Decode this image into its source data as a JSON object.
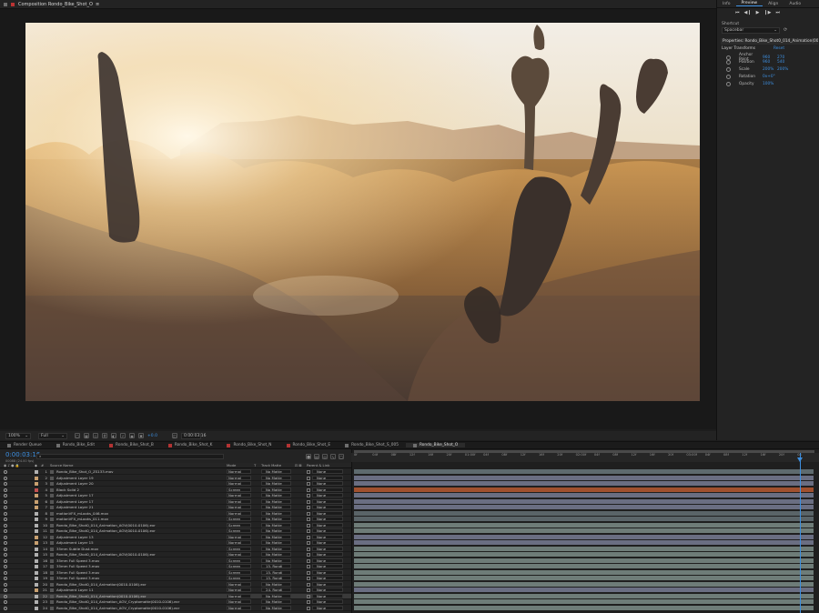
{
  "composition_panel": {
    "tab_label": "Composition Rondo_Bike_Shot_O",
    "zoom": "100%",
    "resolution": "Full",
    "exposure": "+0.0",
    "timecode": "0:00:03:16"
  },
  "right_panel": {
    "tabs": [
      "Info",
      "Preview",
      "Align",
      "Audio"
    ],
    "active_tab": "Preview",
    "transport": [
      "⏮",
      "◀❙",
      "▶",
      "❙▶",
      "⏭"
    ],
    "shortcut_label": "Shortcut",
    "shortcut_value": "Spacebar",
    "properties_header": "Properties: Rondo_Bike_Shot0_014_Animation(0010-",
    "layer_transforms_label": "Layer Transforms",
    "reset_label": "Reset",
    "properties": [
      {
        "name": "Anchor Point",
        "v1": "960",
        "v2": "270"
      },
      {
        "name": "Position",
        "v1": "960",
        "v2": "540"
      },
      {
        "name": "Scale",
        "v1": "200%",
        "v2": "200%"
      },
      {
        "name": "Rotation",
        "v1": "0x+0°",
        "v2": ""
      },
      {
        "name": "Opacity",
        "v1": "100%",
        "v2": ""
      }
    ]
  },
  "timeline_tabs": [
    {
      "label": "Render Queue",
      "color": "#6e6e6e",
      "active": false
    },
    {
      "label": "Rondo_Bike_Edit",
      "color": "#6e6e6e",
      "active": false
    },
    {
      "label": "Rondo_Bike_Shot_B",
      "color": "#b33333",
      "active": false
    },
    {
      "label": "Rondo_Bike_Shot_K",
      "color": "#b33333",
      "active": false
    },
    {
      "label": "Rondo_Bike_Shot_N",
      "color": "#b33333",
      "active": false
    },
    {
      "label": "Rondo_Bike_Shot_E",
      "color": "#b33333",
      "active": false
    },
    {
      "label": "Rondo_Bike_Shot_S_005",
      "color": "#6e6e6e",
      "active": false
    },
    {
      "label": "Rondo_Bike_Shot_O",
      "color": "#6e6e6e",
      "active": true
    }
  ],
  "timeline": {
    "current_time": "0:00:03:16",
    "fps_label": "00088 (24.00 fps)",
    "search_placeholder": "⌕",
    "columns": {
      "source_name": "Source Name",
      "mode": "Mode",
      "t": "T",
      "trkmat": "Track Matte",
      "parent": "Parent & Link"
    },
    "ruler_ticks": [
      "0f",
      "04f",
      "08f",
      "12f",
      "16f",
      "20f",
      "01:00f",
      "04f",
      "08f",
      "12f",
      "16f",
      "20f",
      "02:00f",
      "04f",
      "08f",
      "12f",
      "16f",
      "20f",
      "03:00f",
      "04f",
      "08f",
      "12f",
      "16f",
      "20f",
      "04"
    ],
    "layers": [
      {
        "num": "1",
        "name": "Rondo_Bike_Shot_O_ZS133.mov",
        "mode": "Normal",
        "matte": "No Matte",
        "parent": "None",
        "label": "#b0b0b0",
        "bar": "#5e6a6e"
      },
      {
        "num": "2",
        "name": "Adjustment Layer 19",
        "mode": "Normal",
        "matte": "No Matte",
        "parent": "None",
        "label": "#c8a070",
        "bar": "#6a6e82"
      },
      {
        "num": "3",
        "name": "Adjustment Layer 20",
        "mode": "Normal",
        "matte": "No Matte",
        "parent": "None",
        "label": "#c8a070",
        "bar": "#6a6e82"
      },
      {
        "num": "4",
        "name": "Black Solid 2",
        "mode": "Screen",
        "matte": "No Matte",
        "parent": "None",
        "label": "#c25050",
        "bar": "#a0502e"
      },
      {
        "num": "5",
        "name": "Adjustment Layer 17",
        "mode": "Normal",
        "matte": "No Matte",
        "parent": "None",
        "label": "#c8a070",
        "bar": "#6a6e82"
      },
      {
        "num": "6",
        "name": "Adjustment Layer 17",
        "mode": "Normal",
        "matte": "No Matte",
        "parent": "None",
        "label": "#c8a070",
        "bar": "#6a6e82"
      },
      {
        "num": "7",
        "name": "Adjustment Layer 21",
        "mode": "Normal",
        "matte": "No Matte",
        "parent": "None",
        "label": "#c8a070",
        "bar": "#6a6e82"
      },
      {
        "num": "8",
        "name": "motionVFX_mLooks_046.mov",
        "mode": "Normal",
        "matte": "No Matte",
        "parent": "None",
        "label": "#b0b0b0",
        "bar": "#5a6468"
      },
      {
        "num": "9",
        "name": "motionVFX_mLooks_011.mov",
        "mode": "Screen",
        "matte": "No Matte",
        "parent": "None",
        "label": "#b0b0b0",
        "bar": "#5a6468"
      },
      {
        "num": "10",
        "name": "Rondo_Bike_Shot0_014_Animation_AOV(0010-0106).exr",
        "mode": "Screen",
        "matte": "No Matte",
        "parent": "None",
        "label": "#b0b0b0",
        "bar": "#6e7c78"
      },
      {
        "num": "11",
        "name": "Rondo_Bike_Shot0_014_Animation_AOV(0010-0106).exr",
        "mode": "Screen",
        "matte": "No Matte",
        "parent": "None",
        "label": "#b0b0b0",
        "bar": "#6e7c78"
      },
      {
        "num": "12",
        "name": "Adjustment Layer 13",
        "mode": "Normal",
        "matte": "No Matte",
        "parent": "None",
        "label": "#c8a070",
        "bar": "#6a6e82"
      },
      {
        "num": "13",
        "name": "Adjustment Layer 15",
        "mode": "Normal",
        "matte": "No Matte",
        "parent": "None",
        "label": "#c8a070",
        "bar": "#6a6e82"
      },
      {
        "num": "14",
        "name": "35mm Subtle Dust.mov",
        "mode": "Screen",
        "matte": "No Matte",
        "parent": "None",
        "label": "#b0b0b0",
        "bar": "#6e7c78"
      },
      {
        "num": "15",
        "name": "Rondo_Bike_Shot0_014_Animation_AOV(0010-0106).exr",
        "mode": "Normal",
        "matte": "No Matte",
        "parent": "None",
        "label": "#b0b0b0",
        "bar": "#6e7c78"
      },
      {
        "num": "16",
        "name": "35mm Full Speed 3.mov",
        "mode": "Screen",
        "matte": "No Matte",
        "parent": "None",
        "label": "#b0b0b0",
        "bar": "#6e7c78"
      },
      {
        "num": "17",
        "name": "35mm Full Speed 3.mov",
        "mode": "Screen",
        "matte": "15. Rondi",
        "parent": "None",
        "label": "#b0b0b0",
        "bar": "#6e7c78"
      },
      {
        "num": "18",
        "name": "35mm Full Speed 3.mov",
        "mode": "Screen",
        "matte": "15. Rondi",
        "parent": "None",
        "label": "#b0b0b0",
        "bar": "#6e7c78"
      },
      {
        "num": "19",
        "name": "35mm Full Speed 3.mov",
        "mode": "Screen",
        "matte": "15. Rondi",
        "parent": "None",
        "label": "#b0b0b0",
        "bar": "#6e7c78"
      },
      {
        "num": "20",
        "name": "Rondo_Bike_Shot0_014_Animation(0010-0106).exr",
        "mode": "Normal",
        "matte": "No Matte",
        "parent": "None",
        "label": "#b0b0b0",
        "bar": "#6e7c78"
      },
      {
        "num": "21",
        "name": "Adjustment Layer 11",
        "mode": "Normal",
        "matte": "24. Rondi",
        "parent": "None",
        "label": "#c8a070",
        "bar": "#6a6e82"
      },
      {
        "num": "22",
        "name": "Rondo_Bike_Shot0_014_Animation(0010-0106).exr",
        "mode": "Normal",
        "matte": "No Matte",
        "parent": "None",
        "label": "#b0b0b0",
        "bar": "#6e7c78",
        "selected": true
      },
      {
        "num": "23",
        "name": "Rondo_Bike_Shot0_014_Animation_AOV_Cryptomatte(0010-0106).exr",
        "mode": "Normal",
        "matte": "No Matte",
        "parent": "None",
        "label": "#b0b0b0",
        "bar": "#6e7c78"
      },
      {
        "num": "24",
        "name": "Rondo_Bike_Shot0_014_Animation_AOV_Cryptomatte(0010-0106).exr",
        "mode": "Normal",
        "matte": "No Matte",
        "parent": "None",
        "label": "#b0b0b0",
        "bar": "#6e7c78"
      }
    ]
  },
  "colors": {
    "accent": "#3d8fe0"
  }
}
